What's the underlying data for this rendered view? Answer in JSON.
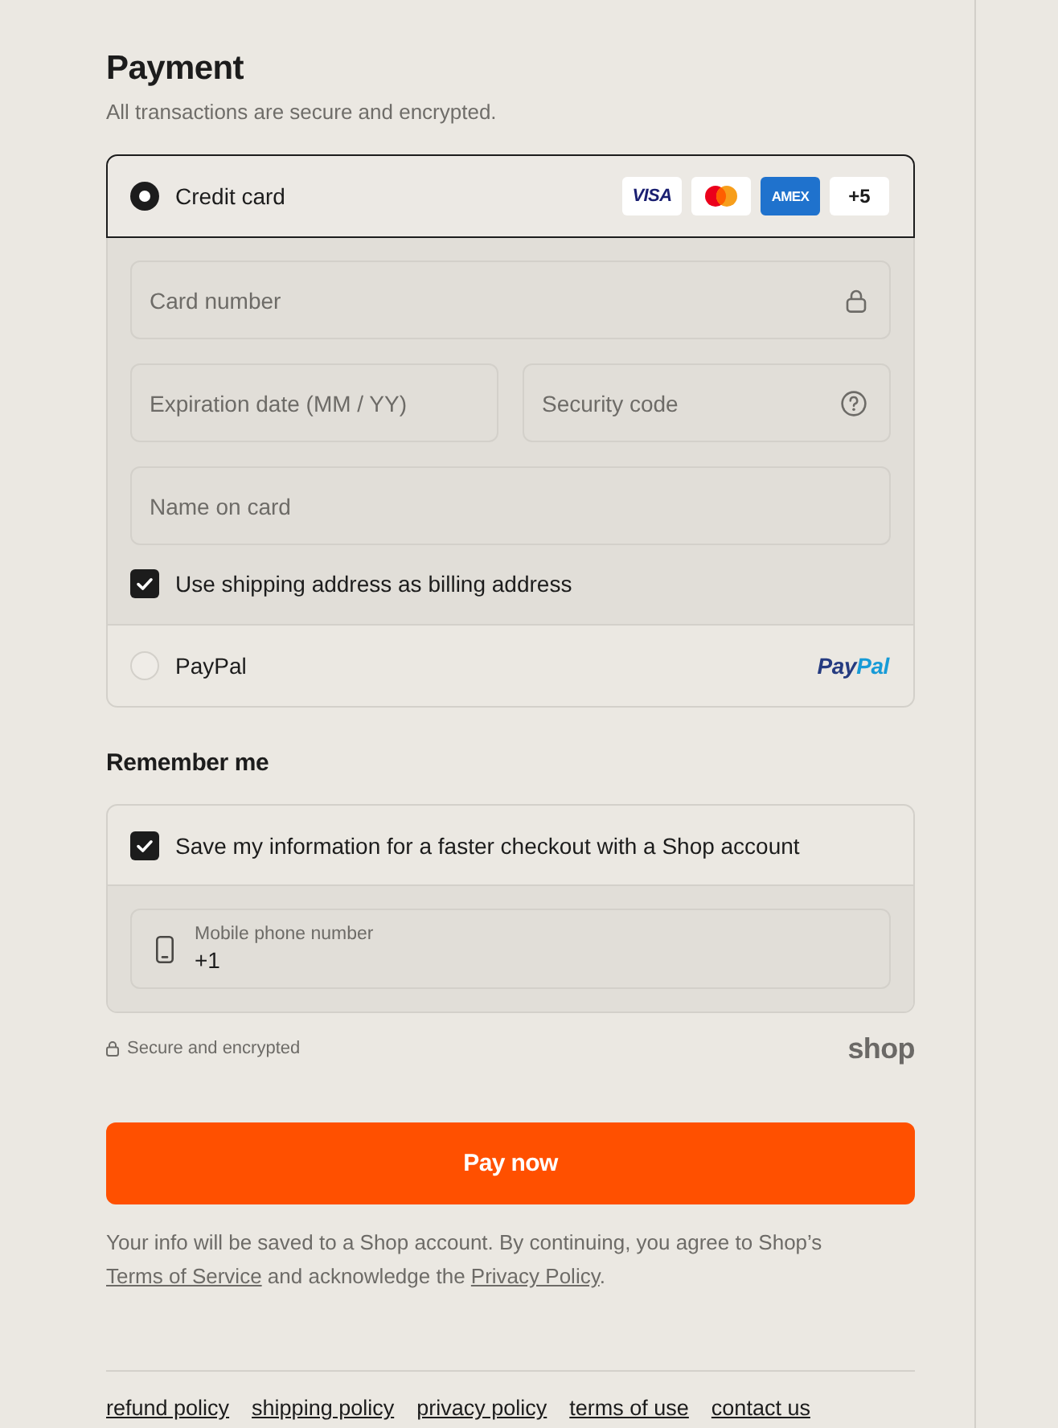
{
  "header": {
    "title": "Payment",
    "subtitle": "All transactions are secure and encrypted."
  },
  "payment_methods": [
    {
      "kind": "card",
      "label": "Credit card",
      "selected": true,
      "brands": [
        {
          "kind": "visa",
          "label": "VISA"
        },
        {
          "kind": "mastercard"
        },
        {
          "kind": "amex",
          "label": "AMEX"
        }
      ],
      "more_brands": "+5",
      "fields": {
        "card_number": {
          "placeholder": "Card number"
        },
        "expiration": {
          "placeholder": "Expiration date (MM / YY)"
        },
        "security_code": {
          "placeholder": "Security code"
        },
        "name": {
          "placeholder": "Name on card"
        }
      },
      "billing_checkbox": {
        "label": "Use shipping address as billing address",
        "checked": true
      }
    },
    {
      "kind": "paypal",
      "label": "PayPal",
      "selected": false,
      "logo_parts": [
        "Pay",
        "Pal"
      ]
    }
  ],
  "remember": {
    "title": "Remember me",
    "save_checkbox": {
      "label": "Save my information for a faster checkout with a Shop account",
      "checked": true
    },
    "phone": {
      "label": "Mobile phone number",
      "value": "+1"
    }
  },
  "security_note": "Secure and encrypted",
  "shop_logo": "shop",
  "pay_button": "Pay now",
  "disclaimer": [
    {
      "kind": "text",
      "text": "Your info will be saved to a Shop account. By continuing, you agree to Shop’s "
    },
    {
      "kind": "link",
      "text": "Terms of Service"
    },
    {
      "kind": "text",
      "text": " and acknowledge the "
    },
    {
      "kind": "link",
      "text": "Privacy Policy"
    },
    {
      "kind": "text",
      "text": "."
    }
  ],
  "footer_links": [
    "refund policy",
    "shipping policy",
    "privacy policy",
    "terms of use",
    "contact us"
  ]
}
